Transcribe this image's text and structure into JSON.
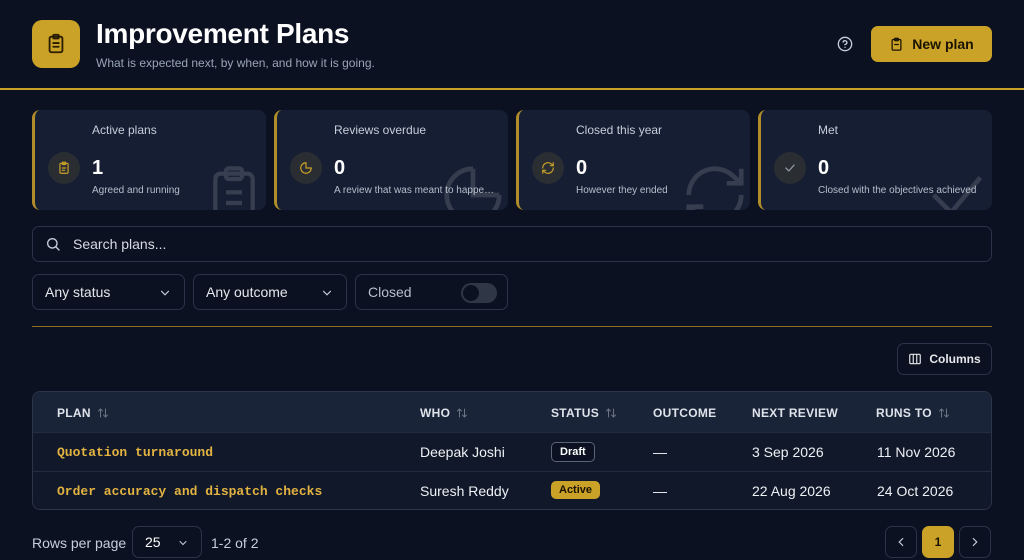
{
  "header": {
    "title": "Improvement Plans",
    "subtitle": "What is expected next, by when, and how it is going.",
    "new_button": "New plan"
  },
  "stats": [
    {
      "label": "Active plans",
      "value": "1",
      "desc": "Agreed and running",
      "icon": "clipboard-icon"
    },
    {
      "label": "Reviews overdue",
      "value": "0",
      "desc": "A review that was meant to happen has passed",
      "icon": "pie-clock-icon"
    },
    {
      "label": "Closed this year",
      "value": "0",
      "desc": "However they ended",
      "icon": "refresh-icon"
    },
    {
      "label": "Met",
      "value": "0",
      "desc": "Closed with the objectives achieved",
      "icon": "check-icon"
    }
  ],
  "search": {
    "placeholder": "Search plans..."
  },
  "filters": {
    "status": "Any status",
    "outcome": "Any outcome",
    "closed_label": "Closed"
  },
  "columns_button": "Columns",
  "table": {
    "headers": {
      "plan": "PLAN",
      "who": "WHO",
      "status": "STATUS",
      "outcome": "OUTCOME",
      "next_review": "NEXT REVIEW",
      "runs_to": "RUNS TO"
    },
    "rows": [
      {
        "plan": "Quotation turnaround",
        "who": "Deepak Joshi",
        "status": "Draft",
        "outcome": "—",
        "next_review": "3 Sep 2026",
        "runs_to": "11 Nov 2026"
      },
      {
        "plan": "Order accuracy and dispatch checks",
        "who": "Suresh Reddy",
        "status": "Active",
        "outcome": "—",
        "next_review": "22 Aug 2026",
        "runs_to": "24 Oct 2026"
      }
    ]
  },
  "footer": {
    "rows_per_page_label": "Rows per page",
    "rows_per_page": "25",
    "range": "1-2 of 2",
    "page": "1"
  },
  "colors": {
    "accent": "#c9a227",
    "background": "#0b1120",
    "card": "#151e33"
  }
}
